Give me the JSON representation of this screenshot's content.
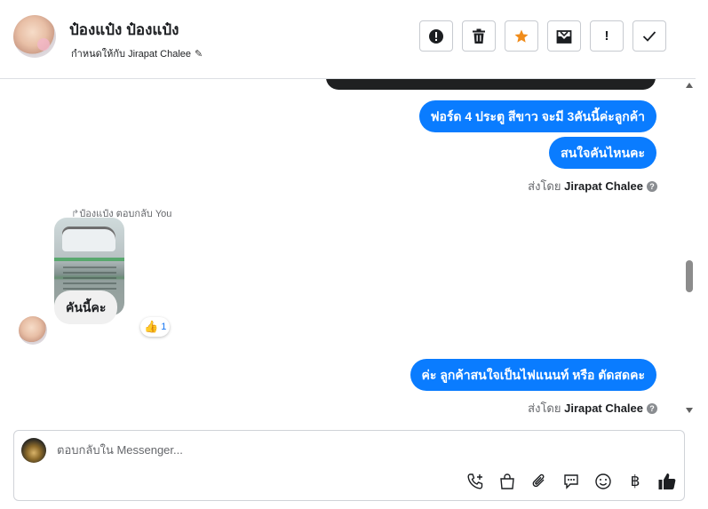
{
  "header": {
    "contact_name": "ป๋องแป๋ง ป๋องแป๋ง",
    "assigned_to": "กำหนดให้กับ Jirapat Chalee",
    "actions": [
      {
        "name": "spam-icon"
      },
      {
        "name": "trash-icon"
      },
      {
        "name": "star-icon",
        "color": "#f08c1a"
      },
      {
        "name": "move-to-inbox-icon"
      },
      {
        "name": "exclamation-icon",
        "glyph": "!"
      },
      {
        "name": "check-icon",
        "glyph": "✓"
      }
    ]
  },
  "messages": {
    "outgoing_1": "ฟอร์ด 4 ประตู สีขาว จะมี 3คันนี้ค่ะลูกค้า",
    "outgoing_2": "สนใจคันไหนคะ",
    "sent_by_prefix_1": "ส่งโดย",
    "sent_by_name_1": "Jirapat Chalee",
    "reply_label": "ป๋องแป๋ง ตอบกลับ You",
    "incoming_1": "คันนี้คะ",
    "reaction_count": "1",
    "outgoing_3": "ค่ะ ลูกค้าสนใจเป็นไฟแนนท์ หรือ ตัดสดคะ",
    "sent_by_prefix_2": "ส่งโดย",
    "sent_by_name_2": "Jirapat Chalee"
  },
  "composer": {
    "placeholder": "ตอบกลับใน Messenger...",
    "tools": [
      "call-add-icon",
      "shopping-bag-icon",
      "paperclip-icon",
      "chat-bubble-icon",
      "emoji-icon",
      "baht-icon",
      "thumbs-up-icon"
    ]
  },
  "colors": {
    "outgoing_bubble": "#0a7cff",
    "incoming_bubble": "#f0f0f0",
    "star": "#f08c1a"
  }
}
